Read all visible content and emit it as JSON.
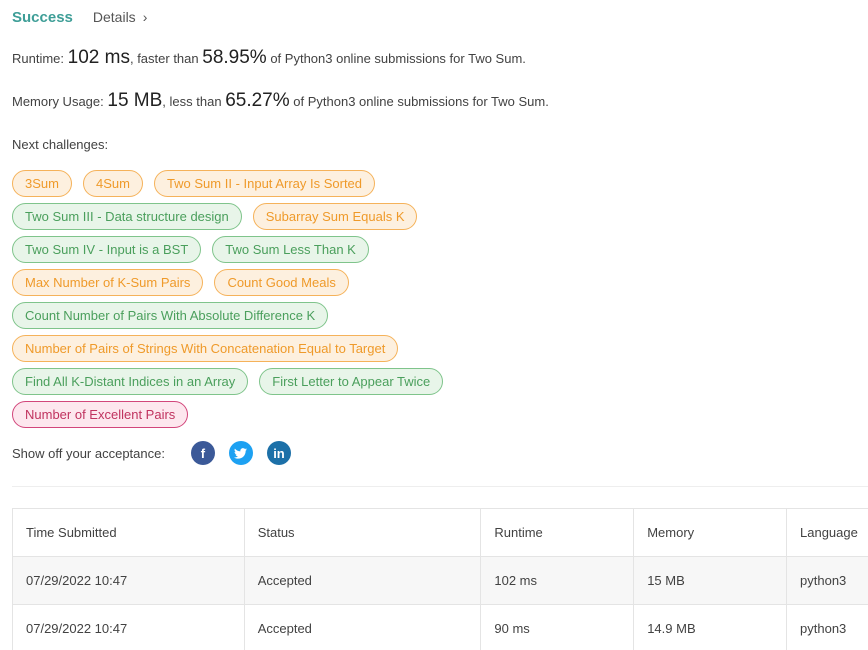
{
  "header": {
    "status": "Success",
    "details_label": "Details",
    "chevron": "›"
  },
  "runtime": {
    "label": "Runtime:",
    "value": "102 ms",
    "mid": ", faster than",
    "percent": "58.95%",
    "tail": "of Python3 online submissions for Two Sum."
  },
  "memory": {
    "label": "Memory Usage:",
    "value": "15 MB",
    "mid": ", less than",
    "percent": "65.27%",
    "tail": "of Python3 online submissions for Two Sum."
  },
  "next_challenges": {
    "label": "Next challenges:",
    "rows": [
      [
        {
          "name": "3Sum",
          "difficulty": "medium"
        },
        {
          "name": "4Sum",
          "difficulty": "medium"
        },
        {
          "name": "Two Sum II - Input Array Is Sorted",
          "difficulty": "medium"
        }
      ],
      [
        {
          "name": "Two Sum III - Data structure design",
          "difficulty": "easy"
        },
        {
          "name": "Subarray Sum Equals K",
          "difficulty": "medium"
        }
      ],
      [
        {
          "name": "Two Sum IV - Input is a BST",
          "difficulty": "easy"
        },
        {
          "name": "Two Sum Less Than K",
          "difficulty": "easy"
        }
      ],
      [
        {
          "name": "Max Number of K-Sum Pairs",
          "difficulty": "medium"
        },
        {
          "name": "Count Good Meals",
          "difficulty": "medium"
        }
      ],
      [
        {
          "name": "Count Number of Pairs With Absolute Difference K",
          "difficulty": "easy"
        }
      ],
      [
        {
          "name": "Number of Pairs of Strings With Concatenation Equal to Target",
          "difficulty": "medium"
        }
      ],
      [
        {
          "name": "Find All K-Distant Indices in an Array",
          "difficulty": "easy"
        },
        {
          "name": "First Letter to Appear Twice",
          "difficulty": "easy"
        }
      ],
      [
        {
          "name": "Number of Excellent Pairs",
          "difficulty": "hard"
        }
      ]
    ]
  },
  "share": {
    "label": "Show off your acceptance:",
    "icons": [
      {
        "name": "facebook-icon",
        "glyph": "f",
        "cls": "fb"
      },
      {
        "name": "twitter-icon",
        "glyph": "🐦",
        "cls": "tw"
      },
      {
        "name": "linkedin-icon",
        "glyph": "in",
        "cls": "li"
      }
    ]
  },
  "submissions": {
    "columns": [
      "Time Submitted",
      "Status",
      "Runtime",
      "Memory",
      "Language"
    ],
    "rows": [
      [
        "07/29/2022 10:47",
        "Accepted",
        "102 ms",
        "15 MB",
        "python3"
      ],
      [
        "07/29/2022 10:47",
        "Accepted",
        "90 ms",
        "14.9 MB",
        "python3"
      ]
    ]
  },
  "colors": {
    "accent": "#3e9e97",
    "medium": "#ef9a2a",
    "easy": "#4a9f5c",
    "hard": "#c0335f"
  }
}
